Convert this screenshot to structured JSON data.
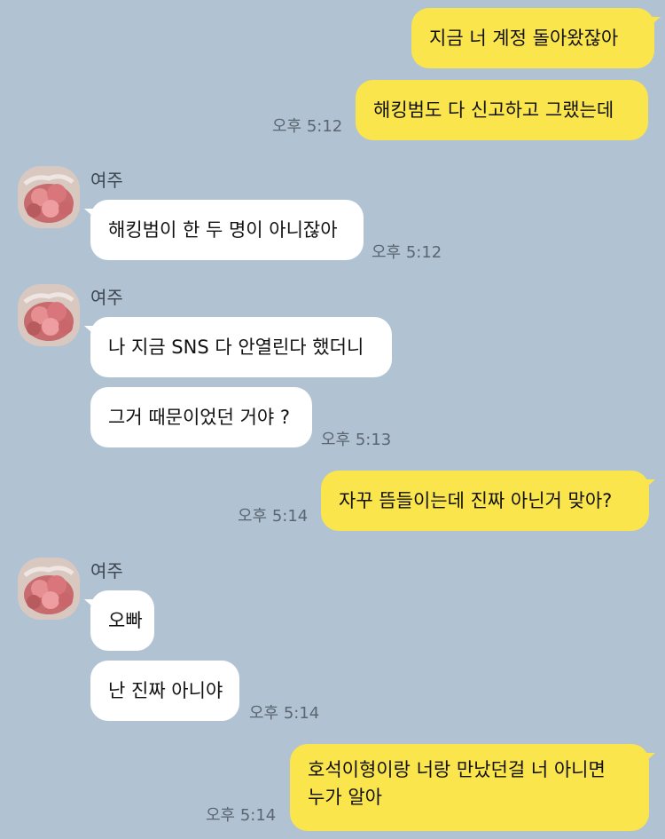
{
  "colors": {
    "background": "#b1c3d3",
    "outgoing_bubble": "#fbe54c",
    "incoming_bubble": "#ffffff"
  },
  "contact": {
    "name": "여주",
    "avatar_icon": "profile-photo-flowers"
  },
  "messages": {
    "m1": "지금 너 계정 돌아왔잖아",
    "m2": "해킹범도 다 신고하고 그랬는데",
    "m3": "해킹범이 한 두 명이 아니잖아",
    "m4": "나 지금 SNS 다 안열린다 했더니",
    "m5": "그거 때문이었던 거야 ?",
    "m6": "자꾸 뜸들이는데 진짜 아닌거 맞아?",
    "m7": "오빠",
    "m8": "난 진짜 아니야",
    "m9": "호석이형이랑 너랑 만났던걸 너 아니면\n누가 알아"
  },
  "times": {
    "t1": "오후 5:12",
    "t2": "오후 5:12",
    "t3": "오후 5:13",
    "t4": "오후 5:14",
    "t5": "오후 5:14",
    "t6": "오후 5:14"
  }
}
